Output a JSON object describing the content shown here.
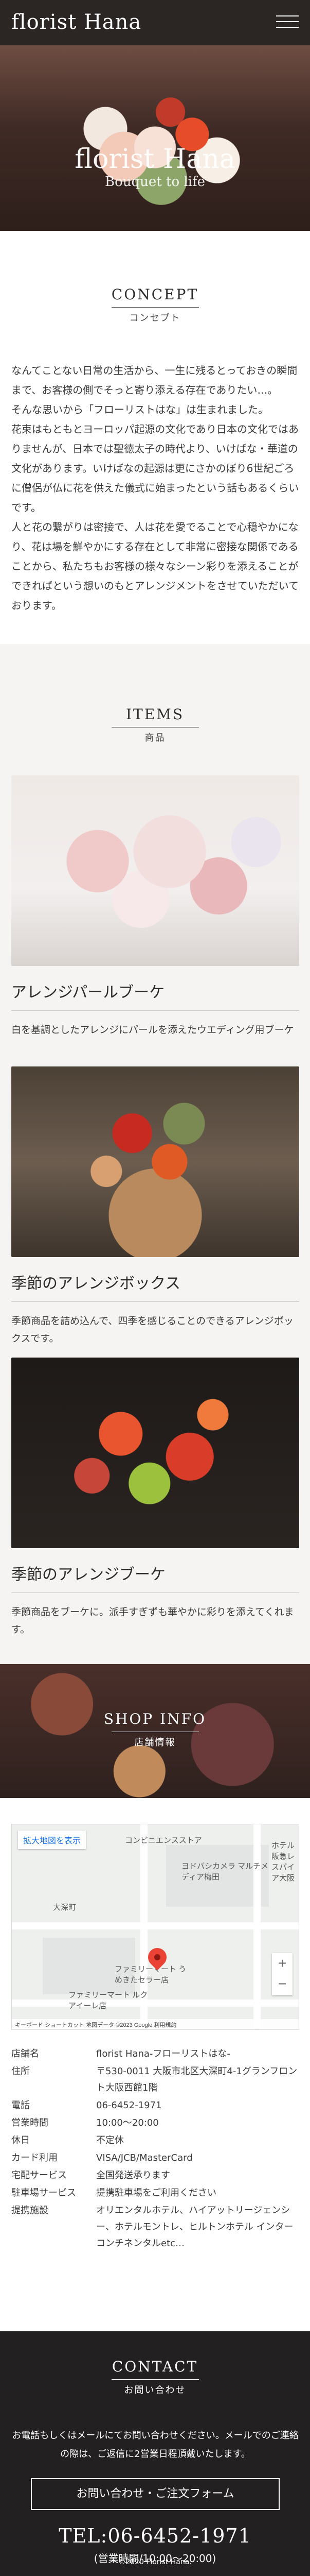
{
  "header": {
    "logo": "florist Hana"
  },
  "hero": {
    "title": "florist Hana",
    "tagline": "Bouquet to life"
  },
  "concept": {
    "title": "CONCEPT",
    "subtitle": "コンセプト",
    "paragraphs": [
      "なんてことない日常の生活から、一生に残るとっておきの瞬間まで、お客様の側でそっと寄り添える存在でありたい…。",
      "そんな思いから「フローリストはな」は生まれました。",
      "花束はもともとヨーロッパ起源の文化であり日本の文化ではありませんが、日本では聖徳太子の時代より、いけばな・華道の文化があります。いけばなの起源は更にさかのぼり6世紀ごろに僧侶が仏に花を供えた儀式に始まったという話もあるくらいです。",
      "人と花の繋がりは密接で、人は花を愛でることで心穏やかになり、花は場を鮮やかにする存在として非常に密接な関係であることから、私たちもお客様の様々なシーン彩りを添えることができればという想いのもとアレンジメントをさせていただいております。"
    ]
  },
  "items": {
    "title": "ITEMS",
    "subtitle": "商品",
    "list": [
      {
        "name": "アレンジパールブーケ",
        "desc": "白を基調としたアレンジにパールを添えたウエディング用ブーケ"
      },
      {
        "name": "季節のアレンジボックス",
        "desc": "季節商品を詰め込んで、四季を感じることのできるアレンジボックスです。"
      },
      {
        "name": "季節のアレンジブーケ",
        "desc": "季節商品をブーケに。派手すぎずも華やかに彩りを添えてくれます。"
      }
    ]
  },
  "shop": {
    "title": "SHOP INFO",
    "subtitle": "店舗情報",
    "map": {
      "expand_label": "拡大地図を表示",
      "labels": [
        "大深町",
        "ファミリーマート うめきたセラー店",
        "ファミリーマート ルクアイーレ店",
        "ヨドバシカメラ マルチメディア梅田",
        "ホテル阪急レスパイア大阪",
        "コンビニエンスストア"
      ],
      "footer": "キーボード ショートカット  地図データ ©2023 Google  利用規約"
    },
    "rows": [
      {
        "key": "店舗名",
        "value": "florist Hana-フローリストはな-"
      },
      {
        "key": "住所",
        "value": "〒530-0011 大阪市北区大深町4-1グランフロント大阪西館1階"
      },
      {
        "key": "電話",
        "value": "06-6452-1971"
      },
      {
        "key": "営業時間",
        "value": "10:00〜20:00"
      },
      {
        "key": "休日",
        "value": "不定休"
      },
      {
        "key": "カード利用",
        "value": "VISA/JCB/MasterCard"
      },
      {
        "key": "宅配サービス",
        "value": "全国発送承ります"
      },
      {
        "key": "駐車場サービス",
        "value": "提携駐車場をご利用ください"
      },
      {
        "key": "提携施設",
        "value": "オリエンタルホテル、ハイアットリージェンシー、ホテルモントレ、ヒルトンホテル インターコンチネンタルetc…"
      }
    ]
  },
  "contact": {
    "title": "CONTACT",
    "subtitle": "お問い合わせ",
    "text": "お電話もしくはメールにてお問い合わせください。メールでのご連絡の際は、ご返信に2営業日程頂戴いたします。",
    "button": "お問い合わせ・ご注文フォーム",
    "tel": "TEL:06-6452-1971",
    "hours": "(営業時間/10:00〜20:00)"
  },
  "footer": {
    "copyright": "©2020 Florist Hana."
  }
}
